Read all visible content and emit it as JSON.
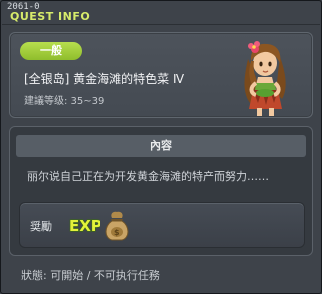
{
  "window": {
    "quest_id": "2061-0",
    "title": "QUEST INFO"
  },
  "header": {
    "category_badge": "一般",
    "quest_name": "[全银岛] 黄金海滩的特色菜 Ⅳ",
    "level_range": "建議等级: 35~39"
  },
  "content": {
    "section_title": "內容",
    "description": "丽尔说自己正在为开发黄金海滩的特产而努力……"
  },
  "reward": {
    "label": "奨勵",
    "exp_text": "EXP"
  },
  "status": "狀態: 可開始 / 不可执行任務",
  "colors": {
    "title": "#d7eb6b",
    "badge": "#9ccc33",
    "exp": "#e3f23a"
  }
}
